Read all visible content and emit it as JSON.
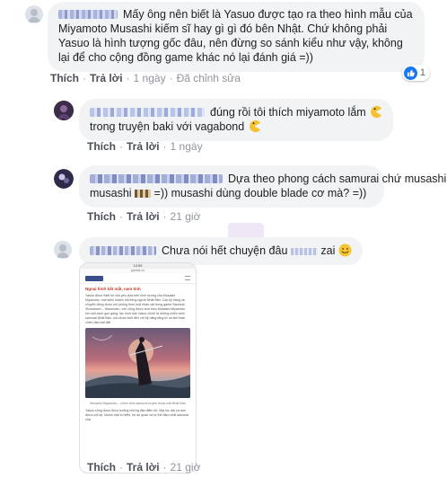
{
  "comments": [
    {
      "text": "Mấy ông nên biết là Yasuo được tạo ra theo hình mẫu của Miyamoto Musashi kiếm sĩ hay gì gì đó bên Nhật. Chứ không phải Yasuo là hình tượng gốc đâu, nên đừng so sánh kiểu như vậy, không lại để cho cộng đồng game khác nó lại đánh giá =))",
      "like_label": "Thích",
      "reply_label": "Trả lời",
      "time": "1 ngày",
      "edited": "Đã chỉnh sửa",
      "reaction_count": "1"
    },
    {
      "text_a": "đúng rồi tôi thích miyamoto lắm",
      "text_b": "trong truyện baki với vagabond",
      "like_label": "Thích",
      "reply_label": "Trả lời",
      "time": "1 ngày"
    },
    {
      "text_a": "Dựa theo phong cách samurai chứ musashi",
      "text_b": "=)) musashi dùng double blade cơ mà? =))",
      "like_label": "Thích",
      "reply_label": "Trả lời",
      "time": "21 giờ"
    },
    {
      "text_a": "Chưa nói hết chuyện đâu",
      "text_b": "zai",
      "like_label": "Thích",
      "reply_label": "Trả lời",
      "time": "21 giờ"
    }
  ],
  "attachment": {
    "status_time": "10:55",
    "url": "gamek.vn",
    "headline": "Ngoại hình bắt mắt, nam tính",
    "body_1": "Yasuo được thiết kế chủ yếu dựa trên hình tượng của Musashi Miyamoto, một kiếm khách nổi tiếng người Nhật Bản. Các kỹ năng và chuyển động được mô phỏng theo một nhân vật trong game Samurai Showdown – Haoumaru, vốn cũng được dựa theo Musashi Miyamoto. Nó một cách gọn gàng, lạc hình của Yasuo chính là những chiến binh samurai Nhật Bản, vốn được biết đến với kỹ năng tăng tử và tinh thần chiến đấu bất diệt",
    "caption": "Musashi Miyamoto – chiến binh samurai huyền thoại của Nhật Bản",
    "body_2": "Yasuo cũng được thừa hưởng những đặc điểm đó. Mái tóc dài và rậm được cột lại, khuôn mặt lo hiểm, bộ áo quần và tư thế đậm chất samurai của"
  },
  "colors": {
    "bubble": "#f2f3f5",
    "like_blue": "#1877f2",
    "action_gray": "#606770",
    "text": "#1c1e21"
  }
}
